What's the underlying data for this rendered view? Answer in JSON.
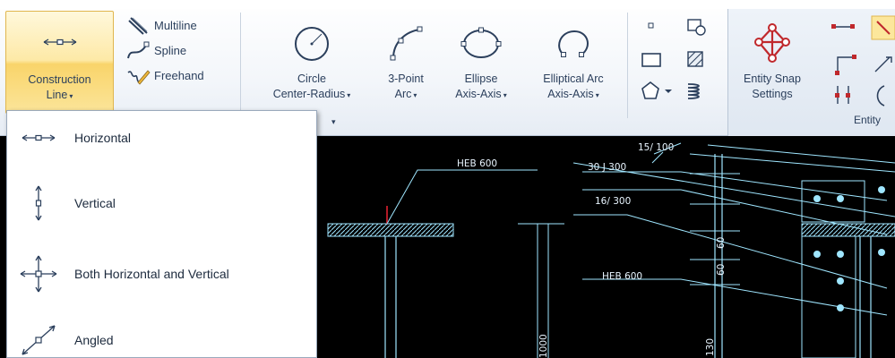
{
  "ribbon": {
    "construction_line": {
      "label1": "Construction",
      "label2": "Line",
      "caret": "▾"
    },
    "small_buttons": [
      {
        "label": "Multiline",
        "icon": "multiline-icon"
      },
      {
        "label": "Spline",
        "icon": "spline-icon"
      },
      {
        "label": "Freehand",
        "icon": "freehand-icon"
      }
    ],
    "circle": {
      "label1": "Circle",
      "label2": "Center-Radius",
      "caret": "▾"
    },
    "arc": {
      "label1": "3-Point",
      "label2": "Arc",
      "caret": "▾"
    },
    "ellipse": {
      "label1": "Ellipse",
      "label2": "Axis-Axis",
      "caret": "▾"
    },
    "elliptical_arc": {
      "label1": "Elliptical Arc",
      "label2": "Axis-Axis",
      "caret": "▾"
    },
    "entity_snap": {
      "label1": "Entity Snap",
      "label2": "Settings"
    },
    "group_footer_caret": "▾",
    "snap_group_footer": "Entity"
  },
  "dropdown": {
    "items": [
      {
        "label": "Horizontal",
        "icon": "horizontal-line-icon"
      },
      {
        "label": "Vertical",
        "icon": "vertical-line-icon"
      },
      {
        "label": "Both Horizontal and Vertical",
        "icon": "cross-line-icon"
      },
      {
        "label": "Angled",
        "icon": "angled-line-icon"
      }
    ]
  },
  "drawing": {
    "labels": [
      "HEB 600",
      "30 J 300",
      "15/ 100",
      "16/ 300",
      "HEB 600",
      "60",
      "60",
      "1000",
      "130"
    ]
  },
  "colors": {
    "accent": "#f9d46a",
    "canvas_bg": "#000000",
    "cad_line": "#9fe6ff"
  }
}
